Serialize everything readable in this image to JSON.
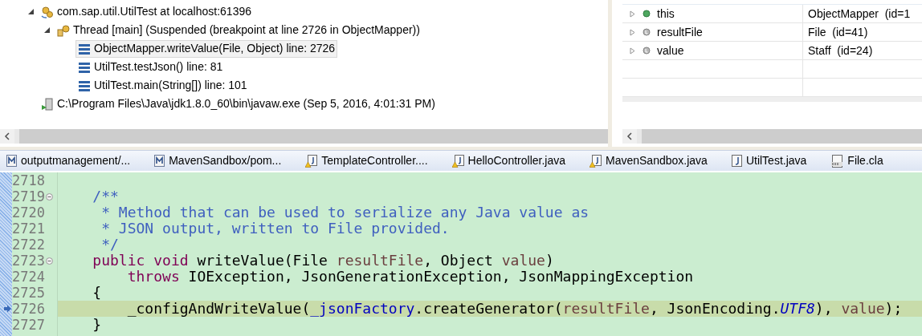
{
  "debug_tree": [
    {
      "kind": "target",
      "label": "com.sap.util.UtilTest at localhost:61396",
      "expanded": true,
      "children": [
        {
          "kind": "thread",
          "label": "Thread [main] (Suspended (breakpoint at line 2726 in ObjectMapper))",
          "expanded": true,
          "children": [
            {
              "kind": "frame",
              "label": "ObjectMapper.writeValue(File, Object) line: 2726",
              "selected": true
            },
            {
              "kind": "frame",
              "label": "UtilTest.testJson() line: 81",
              "selected": false
            },
            {
              "kind": "frame",
              "label": "UtilTest.main(String[]) line: 101",
              "selected": false
            }
          ]
        }
      ]
    },
    {
      "kind": "process",
      "label": "C:\\Program Files\\Java\\jdk1.8.0_60\\bin\\javaw.exe (Sep 5, 2016, 4:01:31 PM)"
    }
  ],
  "variables": [
    {
      "name": "this",
      "value": "ObjectMapper  (id=1",
      "kind": "field",
      "expanded": false
    },
    {
      "name": "resultFile",
      "value": "File  (id=41)",
      "kind": "local",
      "expanded": false
    },
    {
      "name": "value",
      "value": "Staff  (id=24)",
      "kind": "local",
      "expanded": false
    }
  ],
  "editor_tabs": [
    {
      "label": "outputmanagement/...",
      "kind": "maven"
    },
    {
      "label": "MavenSandbox/pom...",
      "kind": "maven"
    },
    {
      "label": "TemplateController....",
      "kind": "java-warning"
    },
    {
      "label": "HelloController.java",
      "kind": "java-warning"
    },
    {
      "label": "MavenSandbox.java",
      "kind": "java-warning"
    },
    {
      "label": "UtilTest.java",
      "kind": "java"
    },
    {
      "label": "File.cla",
      "kind": "class"
    }
  ],
  "code": [
    {
      "number": "2718",
      "foldable": false,
      "current": false
    },
    {
      "number": "2719",
      "foldable": true,
      "current": false,
      "tokens": [
        {
          "text": "    /**",
          "kind": "comment"
        }
      ]
    },
    {
      "number": "2720",
      "foldable": false,
      "current": false,
      "tokens": [
        {
          "text": "     * Method that can be used to serialize any Java value as",
          "kind": "comment"
        }
      ]
    },
    {
      "number": "2721",
      "foldable": false,
      "current": false,
      "tokens": [
        {
          "text": "     * JSON output, written to File provided.",
          "kind": "comment"
        }
      ]
    },
    {
      "number": "2722",
      "foldable": false,
      "current": false,
      "tokens": [
        {
          "text": "     */",
          "kind": "comment"
        }
      ]
    },
    {
      "number": "2723",
      "foldable": true,
      "current": false,
      "tokens": [
        {
          "text": "    public void",
          "kind": "keyword"
        },
        {
          "text": " writeValue(File ",
          "kind": "plain"
        },
        {
          "text": "resultFile",
          "kind": "param"
        },
        {
          "text": ", Object ",
          "kind": "plain"
        },
        {
          "text": "value",
          "kind": "param"
        },
        {
          "text": ")",
          "kind": "plain"
        }
      ]
    },
    {
      "number": "2724",
      "foldable": false,
      "current": false,
      "tokens": [
        {
          "text": "        throws",
          "kind": "keyword"
        },
        {
          "text": " IOException, JsonGenerationException, JsonMappingException",
          "kind": "plain"
        }
      ]
    },
    {
      "number": "2725",
      "foldable": false,
      "current": false,
      "tokens": [
        {
          "text": "    {",
          "kind": "plain"
        }
      ]
    },
    {
      "number": "2726",
      "foldable": false,
      "current": true,
      "tokens": [
        {
          "text": "        _configAndWriteValue(",
          "kind": "plain"
        },
        {
          "text": "_jsonFactory",
          "kind": "field"
        },
        {
          "text": ".createGenerator(",
          "kind": "plain"
        },
        {
          "text": "resultFile",
          "kind": "param"
        },
        {
          "text": ", JsonEncoding.",
          "kind": "plain"
        },
        {
          "text": "UTF8",
          "kind": "constant"
        },
        {
          "text": "), ",
          "kind": "plain"
        },
        {
          "text": "value",
          "kind": "param"
        },
        {
          "text": ");",
          "kind": "plain"
        }
      ]
    },
    {
      "number": "2727",
      "foldable": false,
      "current": false,
      "tokens": [
        {
          "text": "    }",
          "kind": "plain"
        }
      ]
    }
  ]
}
